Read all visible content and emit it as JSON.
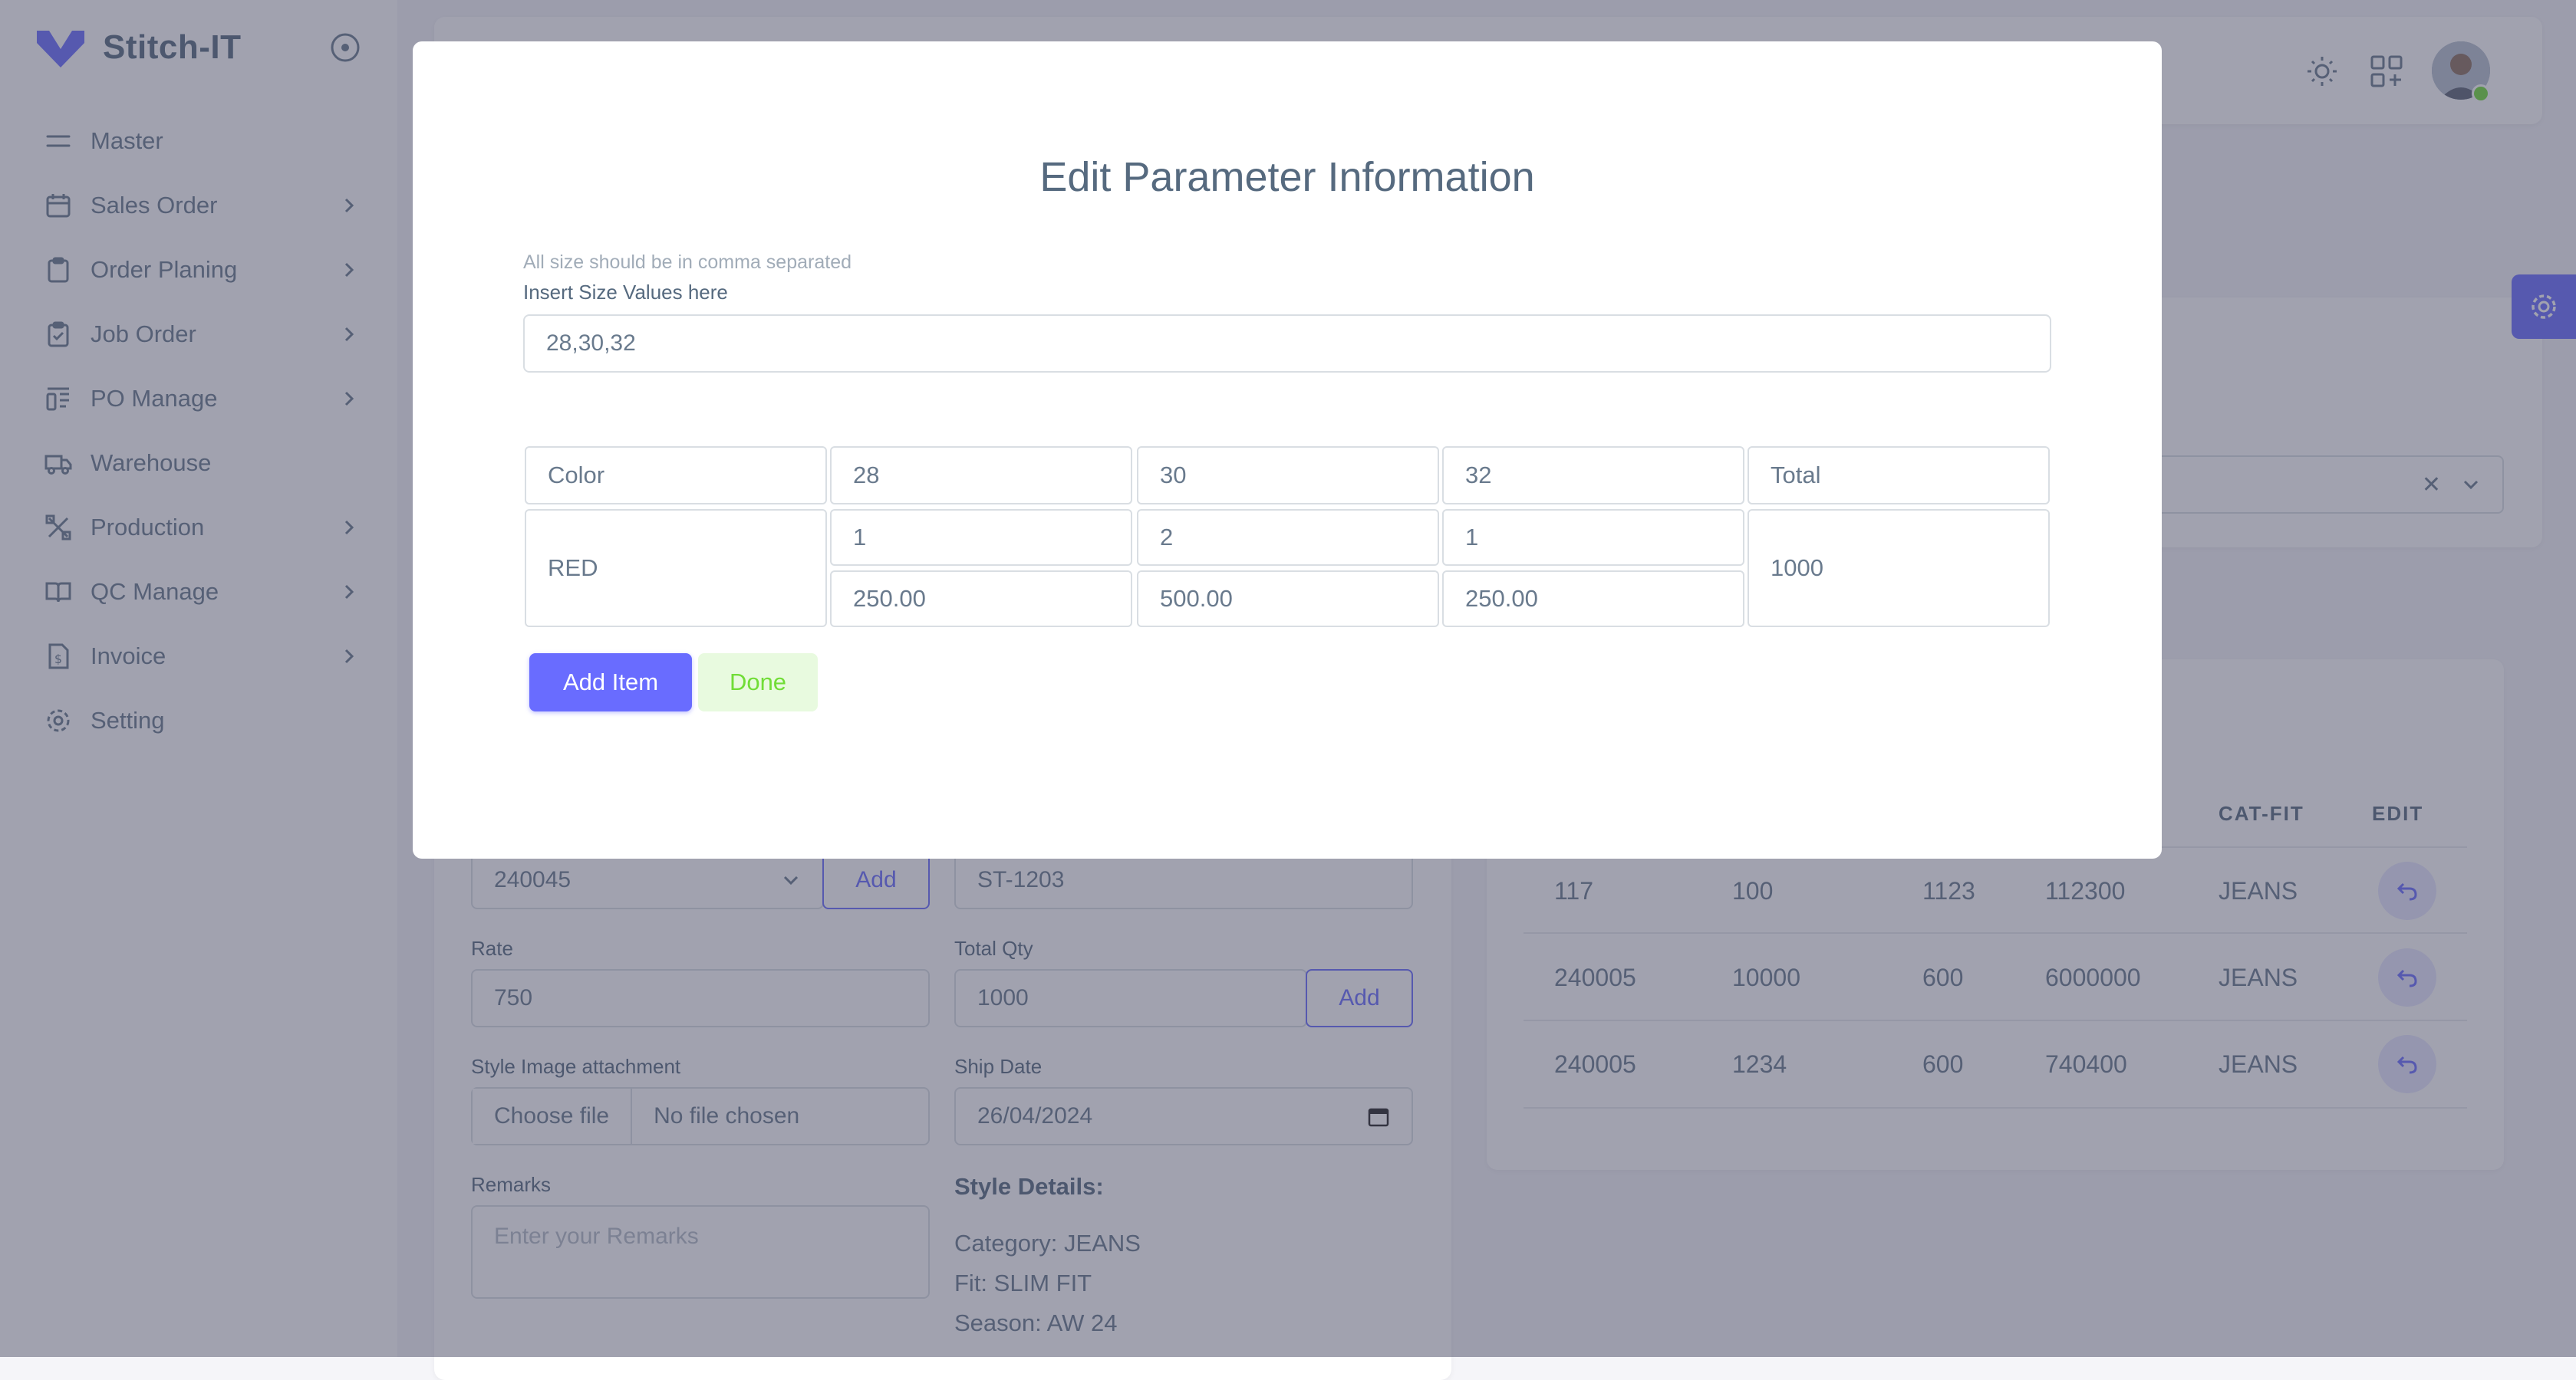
{
  "brand": {
    "name": "Stitch-IT"
  },
  "sidebar": {
    "items": [
      {
        "label": "Master",
        "icon": "menu-lines-icon",
        "has_submenu": false
      },
      {
        "label": "Sales Order",
        "icon": "calendar-icon",
        "has_submenu": true
      },
      {
        "label": "Order Planing",
        "icon": "clipboard-icon",
        "has_submenu": true
      },
      {
        "label": "Job Order",
        "icon": "clipboard-check-icon",
        "has_submenu": true
      },
      {
        "label": "PO Manage",
        "icon": "layout-icon",
        "has_submenu": true
      },
      {
        "label": "Warehouse",
        "icon": "truck-icon",
        "has_submenu": false
      },
      {
        "label": "Production",
        "icon": "tools-icon",
        "has_submenu": true
      },
      {
        "label": "QC Manage",
        "icon": "book-icon",
        "has_submenu": true
      },
      {
        "label": "Invoice",
        "icon": "invoice-icon",
        "has_submenu": true
      },
      {
        "label": "Setting",
        "icon": "gear-icon",
        "has_submenu": false
      }
    ]
  },
  "form": {
    "sales_order_value": "240045",
    "add_label": "Add",
    "style_value": "ST-1203",
    "rate_label": "Rate",
    "rate_value": "750",
    "total_qty_label": "Total Qty",
    "total_qty_value": "1000",
    "qty_add_label": "Add",
    "attachment_label": "Style Image attachment",
    "choose_file_label": "Choose file",
    "no_file_label": "No file chosen",
    "ship_date_label": "Ship Date",
    "ship_date_value": "26/04/2024",
    "remarks_label": "Remarks",
    "remarks_placeholder": "Enter your Remarks",
    "style_details_title": "Style Details:",
    "style_category": "Category: JEANS",
    "style_fit": "Fit: SLIM FIT",
    "style_season": "Season: AW 24"
  },
  "table": {
    "headers": [
      "CAT-FIT",
      "EDIT"
    ],
    "rows": [
      [
        "117",
        "100",
        "1123",
        "112300",
        "JEANS"
      ],
      [
        "240005",
        "10000",
        "600",
        "6000000",
        "JEANS"
      ],
      [
        "240005",
        "1234",
        "600",
        "740400",
        "JEANS"
      ]
    ]
  },
  "modal": {
    "title": "Edit Parameter Information",
    "hint": "All size should be in comma separated",
    "size_label": "Insert Size Values here",
    "size_value": "28,30,32",
    "grid": {
      "headers": [
        "Color",
        "28",
        "30",
        "32",
        "Total"
      ],
      "row": {
        "color": "RED",
        "qty": [
          "1",
          "2",
          "1"
        ],
        "amount": [
          "250.00",
          "500.00",
          "250.00"
        ],
        "total": "1000"
      }
    },
    "add_item_label": "Add Item",
    "done_label": "Done"
  },
  "colors": {
    "primary": "#696cff",
    "success": "#71dd37",
    "overlay": "#434560"
  }
}
